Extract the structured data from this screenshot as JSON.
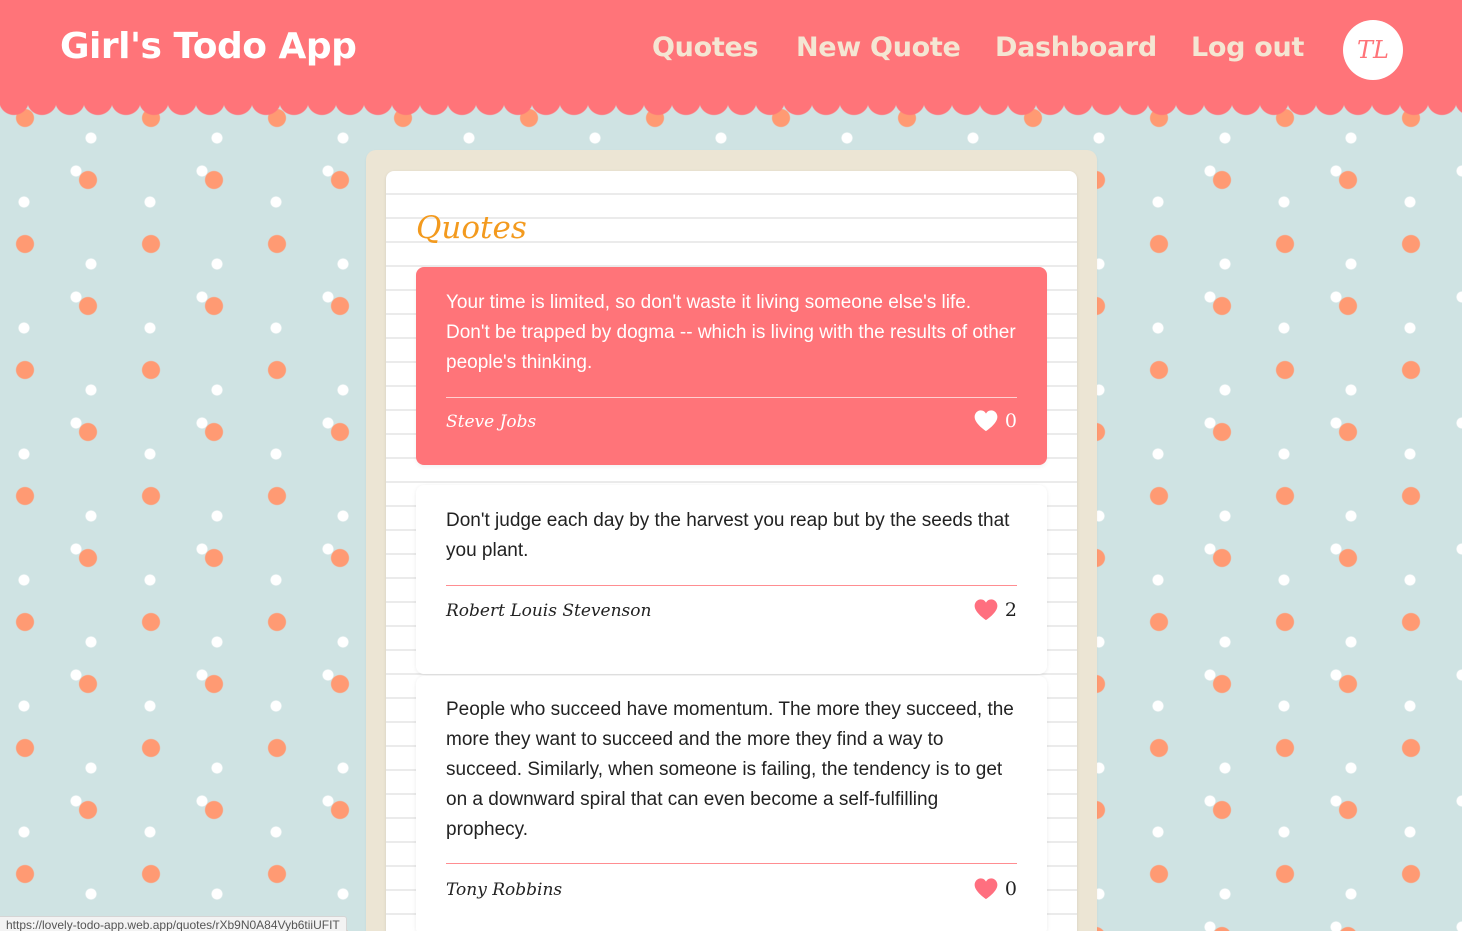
{
  "header": {
    "brand": "Girl's Todo App",
    "nav": {
      "quotes": "Quotes",
      "new_quote": "New Quote",
      "dashboard": "Dashboard",
      "logout": "Log out"
    },
    "avatar_initials": "TL"
  },
  "colors": {
    "header": "#ff7479",
    "nav_text": "#f4e6d3",
    "section_title": "#f39a1e",
    "active_card": "#ff7479",
    "heart": "#ff6f7f",
    "background": "#cfe3e3",
    "dot_orange": "#ff9a73",
    "dot_white": "#ffffff"
  },
  "main": {
    "section_title": "Quotes",
    "quotes": [
      {
        "text": "Your time is limited, so don't waste it living someone else's life. Don't be trapped by dogma -- which is living with the results of other people's thinking.",
        "author": "Steve Jobs",
        "likes": "0",
        "active": true,
        "icon": "heart-icon"
      },
      {
        "text": "Don't judge each day by the harvest you reap but by the seeds that you plant.",
        "author": "Robert Louis Stevenson",
        "likes": "2",
        "active": false,
        "icon": "heart-icon"
      },
      {
        "text": "People who succeed have momentum. The more they succeed, the more they want to succeed and the more they find a way to succeed. Similarly, when someone is failing, the tendency is to get on a downward spiral that can even become a self-fulfilling prophecy.",
        "author": "Tony Robbins",
        "likes": "0",
        "active": false,
        "icon": "heart-icon"
      }
    ]
  },
  "status_bar": {
    "url": "https://lovely-todo-app.web.app/quotes/rXb9N0A84Vyb6tiiUFIT"
  }
}
